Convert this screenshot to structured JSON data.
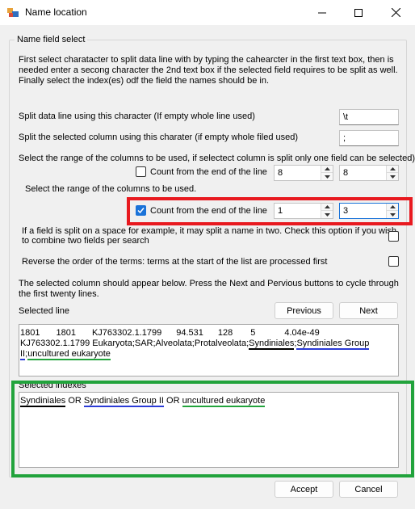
{
  "window": {
    "title": "Name location"
  },
  "groupbox": {
    "legend": "Name field select",
    "instructions": "First select charatacter to split data line with by typing the cahearcter in the first text box, then is needed enter a secong character the 2nd text box if the selected field requires to be split as well. Finally select the index(es) odf the field the names should be in."
  },
  "split_line": {
    "label": "Split data line using this character (If empty whole line used)",
    "value": "\\t"
  },
  "split_column": {
    "label": "Split the selected column using this charater (if empty whole filed used)",
    "value": ";"
  },
  "range1": {
    "label": "Select the range of the columns to be used, if selectect column is split only one field can be selected)",
    "checkbox_label": "Count from the end of the line",
    "checked": false,
    "from": "8",
    "to": "8"
  },
  "range2": {
    "label": "Select the range of the columns to be used.",
    "checkbox_label": "Count from the end of the line",
    "checked": true,
    "from": "1",
    "to": "3"
  },
  "combine": {
    "label_line1": "If a field is split on a space for example, it may split a name in two. Check this option if you wish",
    "label_line2": "to combine two fields per search",
    "checked": false
  },
  "reverse": {
    "label": "Reverse the order of the terms: terms at the start of the list are processed first",
    "checked": false
  },
  "selected_info": {
    "line1": "The selected column should appear below. Press the Next and Pervious buttons to cycle through",
    "line2": "the first twenty lines."
  },
  "selected_line": {
    "label": "Selected line",
    "previous_label": "Previous",
    "next_label": "Next",
    "row1": [
      "1801",
      "1801",
      "KJ763302.1.1799",
      "94.531",
      "128",
      "5",
      "4.04e-49"
    ],
    "row2_prefix": "KJ763302.1.1799 Eukaryota;SAR;Alveolata;Protalveolata;",
    "row2_term1": "Syndiniales",
    "row2_sep": ";",
    "row2_term2": "Syndiniales Group",
    "row3_term2_cont": "II",
    "row3_term3": "uncultured eukaryote"
  },
  "selected_indexes": {
    "label": "Selected indexes",
    "term1": "Syndiniales",
    "or1": "OR",
    "term2": "Syndiniales Group II",
    "or2": "OR",
    "term3": "uncultured eukaryote"
  },
  "footer": {
    "accept_label": "Accept",
    "cancel_label": "Cancel"
  },
  "colors": {
    "highlight_red": "#e8191f",
    "highlight_green": "#22a33c",
    "underline_blue": "#2b3bd6",
    "checkbox_blue": "#1a73d9"
  }
}
